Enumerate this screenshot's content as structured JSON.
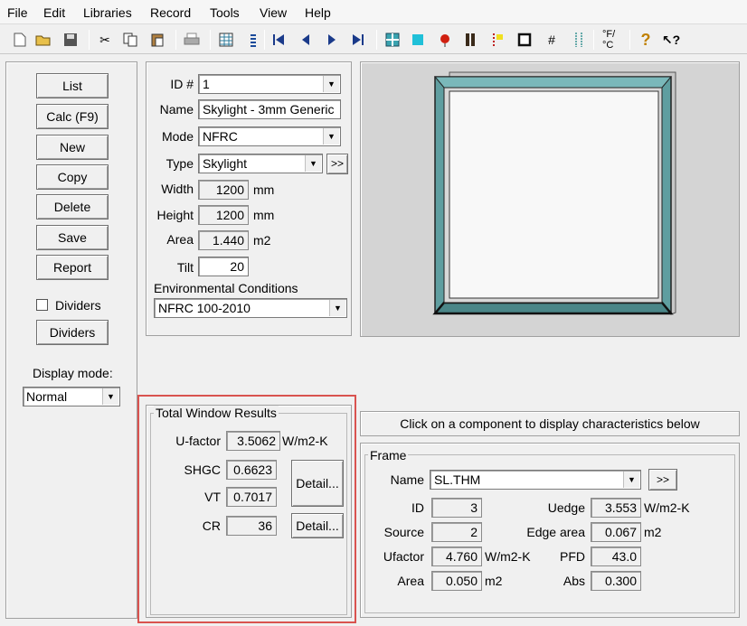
{
  "menu": {
    "file": "File",
    "edit": "Edit",
    "libraries": "Libraries",
    "record": "Record",
    "tools": "Tools",
    "view": "View",
    "help": "Help"
  },
  "toolbar": {
    "icons": [
      "new-document-icon",
      "open-folder-icon",
      "save-disk-icon",
      "cut-icon",
      "copy-icon",
      "paste-icon",
      "print-icon",
      "grid-view-icon",
      "list-view-icon",
      "first-record-icon",
      "previous-record-icon",
      "next-record-icon",
      "last-record-icon",
      "glazing-icon",
      "gap-icon",
      "shading-icon",
      "frame-icon",
      "divider-icon",
      "window-icon",
      "hash-icon",
      "spacer-icon",
      "temperature-conversion-icon",
      "help-icon",
      "context-help-icon"
    ],
    "temp_label": "°F/°C"
  },
  "left": {
    "buttons": {
      "list": "List",
      "calc": "Calc (F9)",
      "new": "New",
      "copy": "Copy",
      "delete": "Delete",
      "save": "Save",
      "report": "Report",
      "dividers": "Dividers"
    },
    "dividers_checkbox": "Dividers",
    "display_mode_label": "Display mode:",
    "display_mode_value": "Normal"
  },
  "form": {
    "id_label": "ID #",
    "id_value": "1",
    "name_label": "Name",
    "name_value": "Skylight - 3mm Generic",
    "mode_label": "Mode",
    "mode_value": "NFRC",
    "type_label": "Type",
    "type_value": "Skylight",
    "type_more": ">>",
    "width_label": "Width",
    "width_value": "1200",
    "width_unit": "mm",
    "height_label": "Height",
    "height_value": "1200",
    "height_unit": "mm",
    "area_label": "Area",
    "area_value": "1.440",
    "area_unit": "m2",
    "tilt_label": "Tilt",
    "tilt_value": "20",
    "env_label": "Environmental Conditions",
    "env_value": "NFRC 100-2010"
  },
  "results": {
    "title": "Total Window Results",
    "ufactor_label": "U-factor",
    "ufactor_value": "3.5062",
    "ufactor_unit": "W/m2-K",
    "shgc_label": "SHGC",
    "shgc_value": "0.6623",
    "vt_label": "VT",
    "vt_value": "0.7017",
    "cr_label": "CR",
    "cr_value": "36",
    "detail1": "Detail...",
    "detail2": "Detail..."
  },
  "component_hint": "Click on a component to display characteristics below",
  "frame": {
    "title": "Frame",
    "name_label": "Name",
    "name_value": "SL.THM",
    "name_more": ">>",
    "id_label": "ID",
    "id_value": "3",
    "source_label": "Source",
    "source_value": "2",
    "ufactor_label": "Ufactor",
    "ufactor_value": "4.760",
    "ufactor_unit": "W/m2-K",
    "area_label": "Area",
    "area_value": "0.050",
    "area_unit": "m2",
    "uedge_label": "Uedge",
    "uedge_value": "3.553",
    "uedge_unit": "W/m2-K",
    "edge_area_label": "Edge area",
    "edge_area_value": "0.067",
    "edge_area_unit": "m2",
    "pfd_label": "PFD",
    "pfd_value": "43.0",
    "abs_label": "Abs",
    "abs_value": "0.300"
  },
  "colors": {
    "highlight": "#d9534f",
    "frame_teal": "#5f9ea0",
    "preview_bg": "#d4d4d4"
  }
}
